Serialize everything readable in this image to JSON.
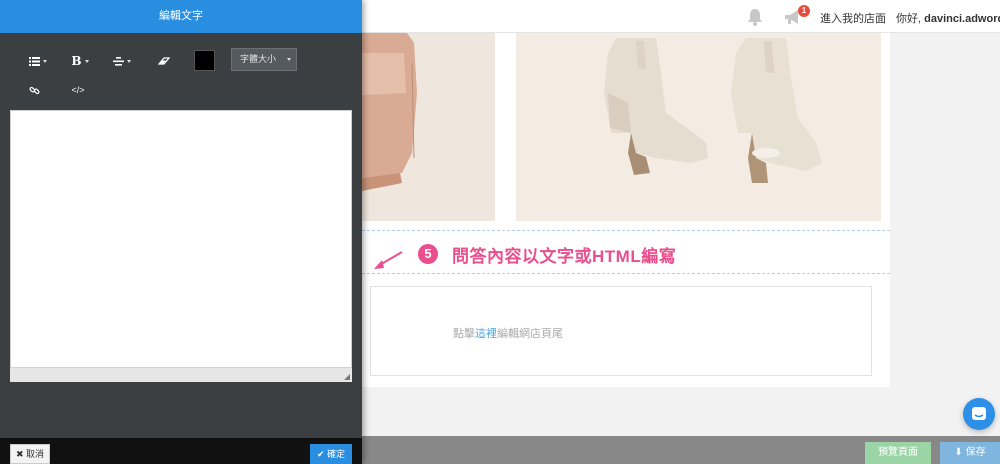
{
  "panel": {
    "title": "編輯文字",
    "toolbar": {
      "list_icon": "list-icon",
      "bold_label": "B",
      "align_icon": "align-center-icon",
      "eraser_icon": "eraser-icon",
      "text_color": "#000000",
      "font_size_label": "字體大小",
      "link_icon": "link-icon",
      "code_label": "</>"
    },
    "cancel_label": "取消",
    "ok_label": "確定"
  },
  "topbar": {
    "notification_count": "1",
    "enter_store_label": "進入我的店面",
    "greeting_prefix": "你好,",
    "username": "davinci.adwords"
  },
  "annotation": {
    "step_number": "5",
    "text": "問答內容以文字或HTML編寫"
  },
  "footer_hint": {
    "before": "點擊",
    "link": "這裡",
    "after": "編輯網店頁尾"
  },
  "bottombar": {
    "preview_label": "預覽頁面",
    "save_label": "保存"
  },
  "colors": {
    "accent": "#2a8ee0",
    "annotation": "#e94f8e",
    "panel_bg": "#3c3f42"
  }
}
